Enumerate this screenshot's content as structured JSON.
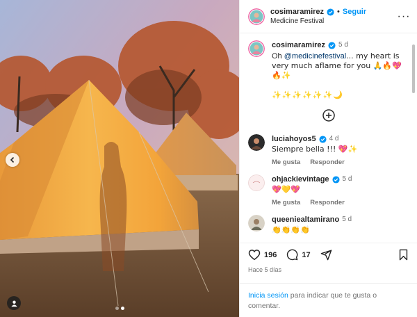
{
  "post": {
    "username": "cosimaramirez",
    "follow_label": "Seguir",
    "separator": "•",
    "location": "Medicine Festival",
    "more_label": "···"
  },
  "caption": {
    "username": "cosimaramirez",
    "time": "5 d",
    "text_prefix": "Oh ",
    "mention": "@medicinefestival",
    "text_suffix": "... my heart is very much aflame for you 🙏🔥💖🔥✨",
    "emoji_line": "✨✨✨✨✨✨🌙"
  },
  "comments": [
    {
      "username": "luciahoyos5",
      "verified": true,
      "time": "4 d",
      "text": "Siempre bella !!! 💖✨",
      "like_label": "Me gusta",
      "reply_label": "Responder"
    },
    {
      "username": "ohjackievintage",
      "verified": true,
      "time": "5 d",
      "text": "💖💛💖",
      "like_label": "Me gusta",
      "reply_label": "Responder"
    },
    {
      "username": "queeniealtamirano",
      "verified": false,
      "time": "5 d",
      "text": "👏👏👏👏",
      "like_label": "",
      "reply_label": ""
    }
  ],
  "actions": {
    "likes": "196",
    "comments": "17"
  },
  "time_ago": "Hace 5 días",
  "login_prompt": {
    "link": "Inicia sesión",
    "text": " para indicar que te gusta o comentar."
  },
  "colors": {
    "accent": "#0095f6",
    "verified": "#0095f6",
    "secondary_text": "#737373"
  },
  "icons": [
    "chevron-left-icon",
    "user-tag-icon",
    "verified-icon",
    "more-icon",
    "add-circle-icon",
    "heart-icon",
    "comment-icon",
    "share-icon",
    "bookmark-icon"
  ]
}
